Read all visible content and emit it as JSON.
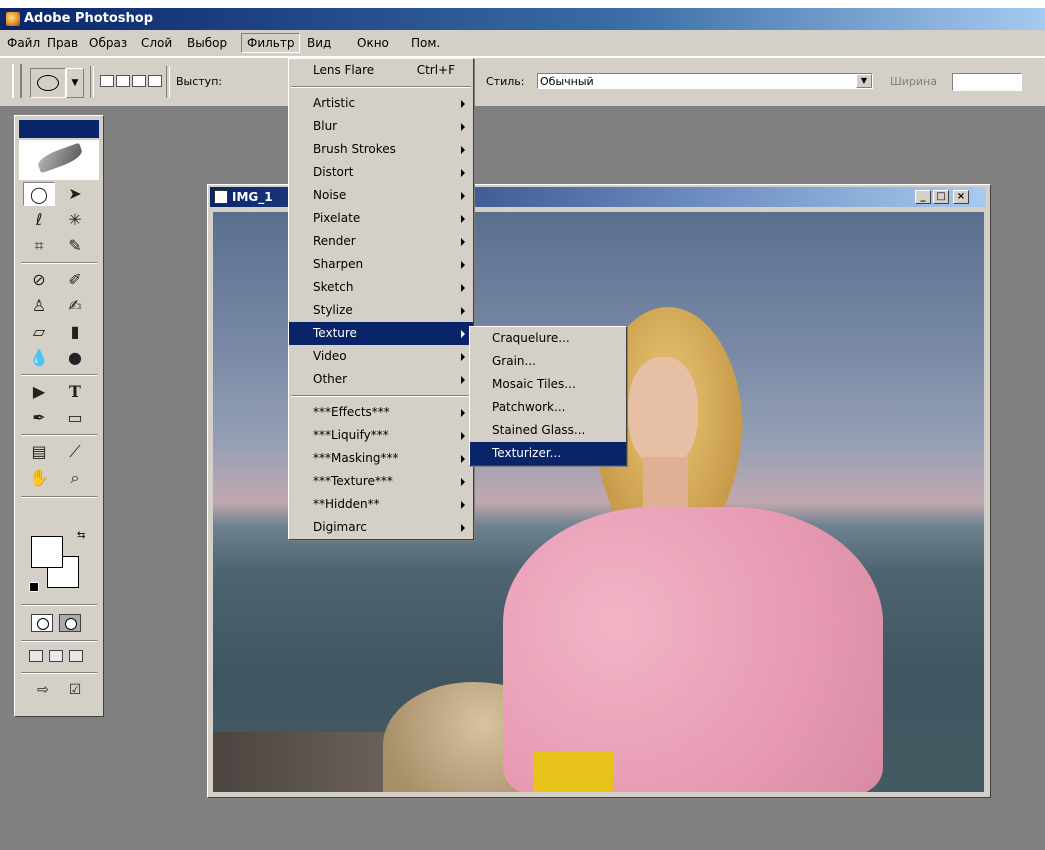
{
  "app": {
    "title": "Adobe Photoshop"
  },
  "menubar": {
    "items": [
      "Файл",
      "Прав",
      "Образ",
      "Слой",
      "Выбор",
      "Фильтр",
      "Вид",
      "Окно",
      "Пом."
    ]
  },
  "options": {
    "feather_label": "Выступ:",
    "style_label": "Стиль:",
    "style_value": "Обычный",
    "width_label": "Ширина"
  },
  "document": {
    "title": "IMG_1"
  },
  "filter_menu": {
    "last_filter": {
      "label": "Lens Flare",
      "shortcut": "Ctrl+F"
    },
    "groups": [
      [
        "Artistic",
        "Blur",
        "Brush Strokes",
        "Distort",
        "Noise",
        "Pixelate",
        "Render",
        "Sharpen",
        "Sketch",
        "Stylize",
        "Texture",
        "Video",
        "Other"
      ],
      [
        "***Effects***",
        "***Liquify***",
        "***Masking***",
        "***Texture***",
        "**Hidden**",
        "Digimarc"
      ]
    ],
    "highlighted": "Texture"
  },
  "texture_submenu": {
    "items": [
      "Craquelure...",
      "Grain...",
      "Mosaic Tiles...",
      "Patchwork...",
      "Stained Glass...",
      "Texturizer..."
    ],
    "highlighted": "Texturizer..."
  },
  "colors": {
    "title_bar": "#0a246a",
    "menu_highlight": "#0a246a",
    "chrome": "#d4d0c8",
    "workspace": "#808080"
  }
}
